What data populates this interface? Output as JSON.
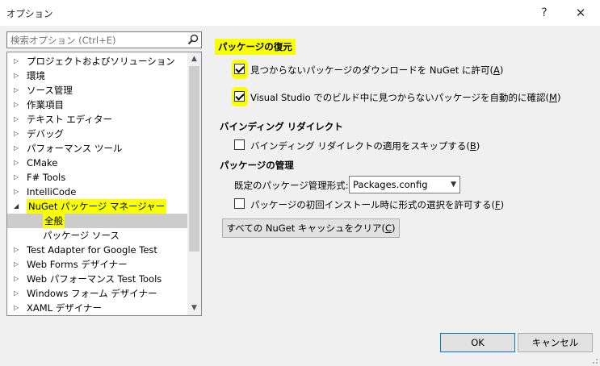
{
  "window": {
    "title": "オプション",
    "help_glyph": "?",
    "close_glyph": "✕"
  },
  "search": {
    "placeholder": "検索オプション (Ctrl+E)"
  },
  "tree": {
    "items": [
      {
        "label": "プロジェクトおよびソリューション",
        "expanded": false
      },
      {
        "label": "環境",
        "expanded": false
      },
      {
        "label": "ソース管理",
        "expanded": false
      },
      {
        "label": "作業項目",
        "expanded": false
      },
      {
        "label": "テキスト エディター",
        "expanded": false
      },
      {
        "label": "デバッグ",
        "expanded": false
      },
      {
        "label": "パフォーマンス ツール",
        "expanded": false
      },
      {
        "label": "CMake",
        "expanded": false
      },
      {
        "label": "F# Tools",
        "expanded": false
      },
      {
        "label": "IntelliCode",
        "expanded": false
      },
      {
        "label": "NuGet パッケージ マネージャー",
        "expanded": true
      },
      {
        "label": "全般",
        "child": true,
        "selected": true
      },
      {
        "label": "パッケージ ソース",
        "child": true
      },
      {
        "label": "Test Adapter for Google Test",
        "expanded": false
      },
      {
        "label": "Web Forms デザイナー",
        "expanded": false
      },
      {
        "label": "Web パフォーマンス Test Tools",
        "expanded": false
      },
      {
        "label": "Windows フォーム デザイナー",
        "expanded": false
      },
      {
        "label": "XAML デザイナー",
        "expanded": false
      }
    ]
  },
  "restore": {
    "heading": "パッケージの復元",
    "opt1_label": "見つからないパッケージのダウンロードを NuGet に許可(",
    "opt1_key": "A",
    "opt2_label": "Visual Studio でのビルド中に見つからないパッケージを自動的に確認(",
    "opt2_key": "M"
  },
  "binding": {
    "heading": "バインディング リダイレクト",
    "opt_label": "バインディング リダイレクトの適用をスキップする(",
    "opt_key": "B"
  },
  "manage": {
    "heading": "パッケージの管理",
    "format_label": "既定のパッケージ管理形式:",
    "format_value": "Packages.config",
    "opt_label": "パッケージの初回インストール時に形式の選択を許可する(",
    "opt_key": "F",
    "clear_label": "すべての NuGet キャッシュをクリア(",
    "clear_key": "C"
  },
  "buttons": {
    "ok": "OK",
    "cancel": "キャンセル"
  },
  "colors": {
    "highlight": "#f8ff00",
    "selected_row": "#cccccc",
    "ok_border": "#0078d7"
  }
}
